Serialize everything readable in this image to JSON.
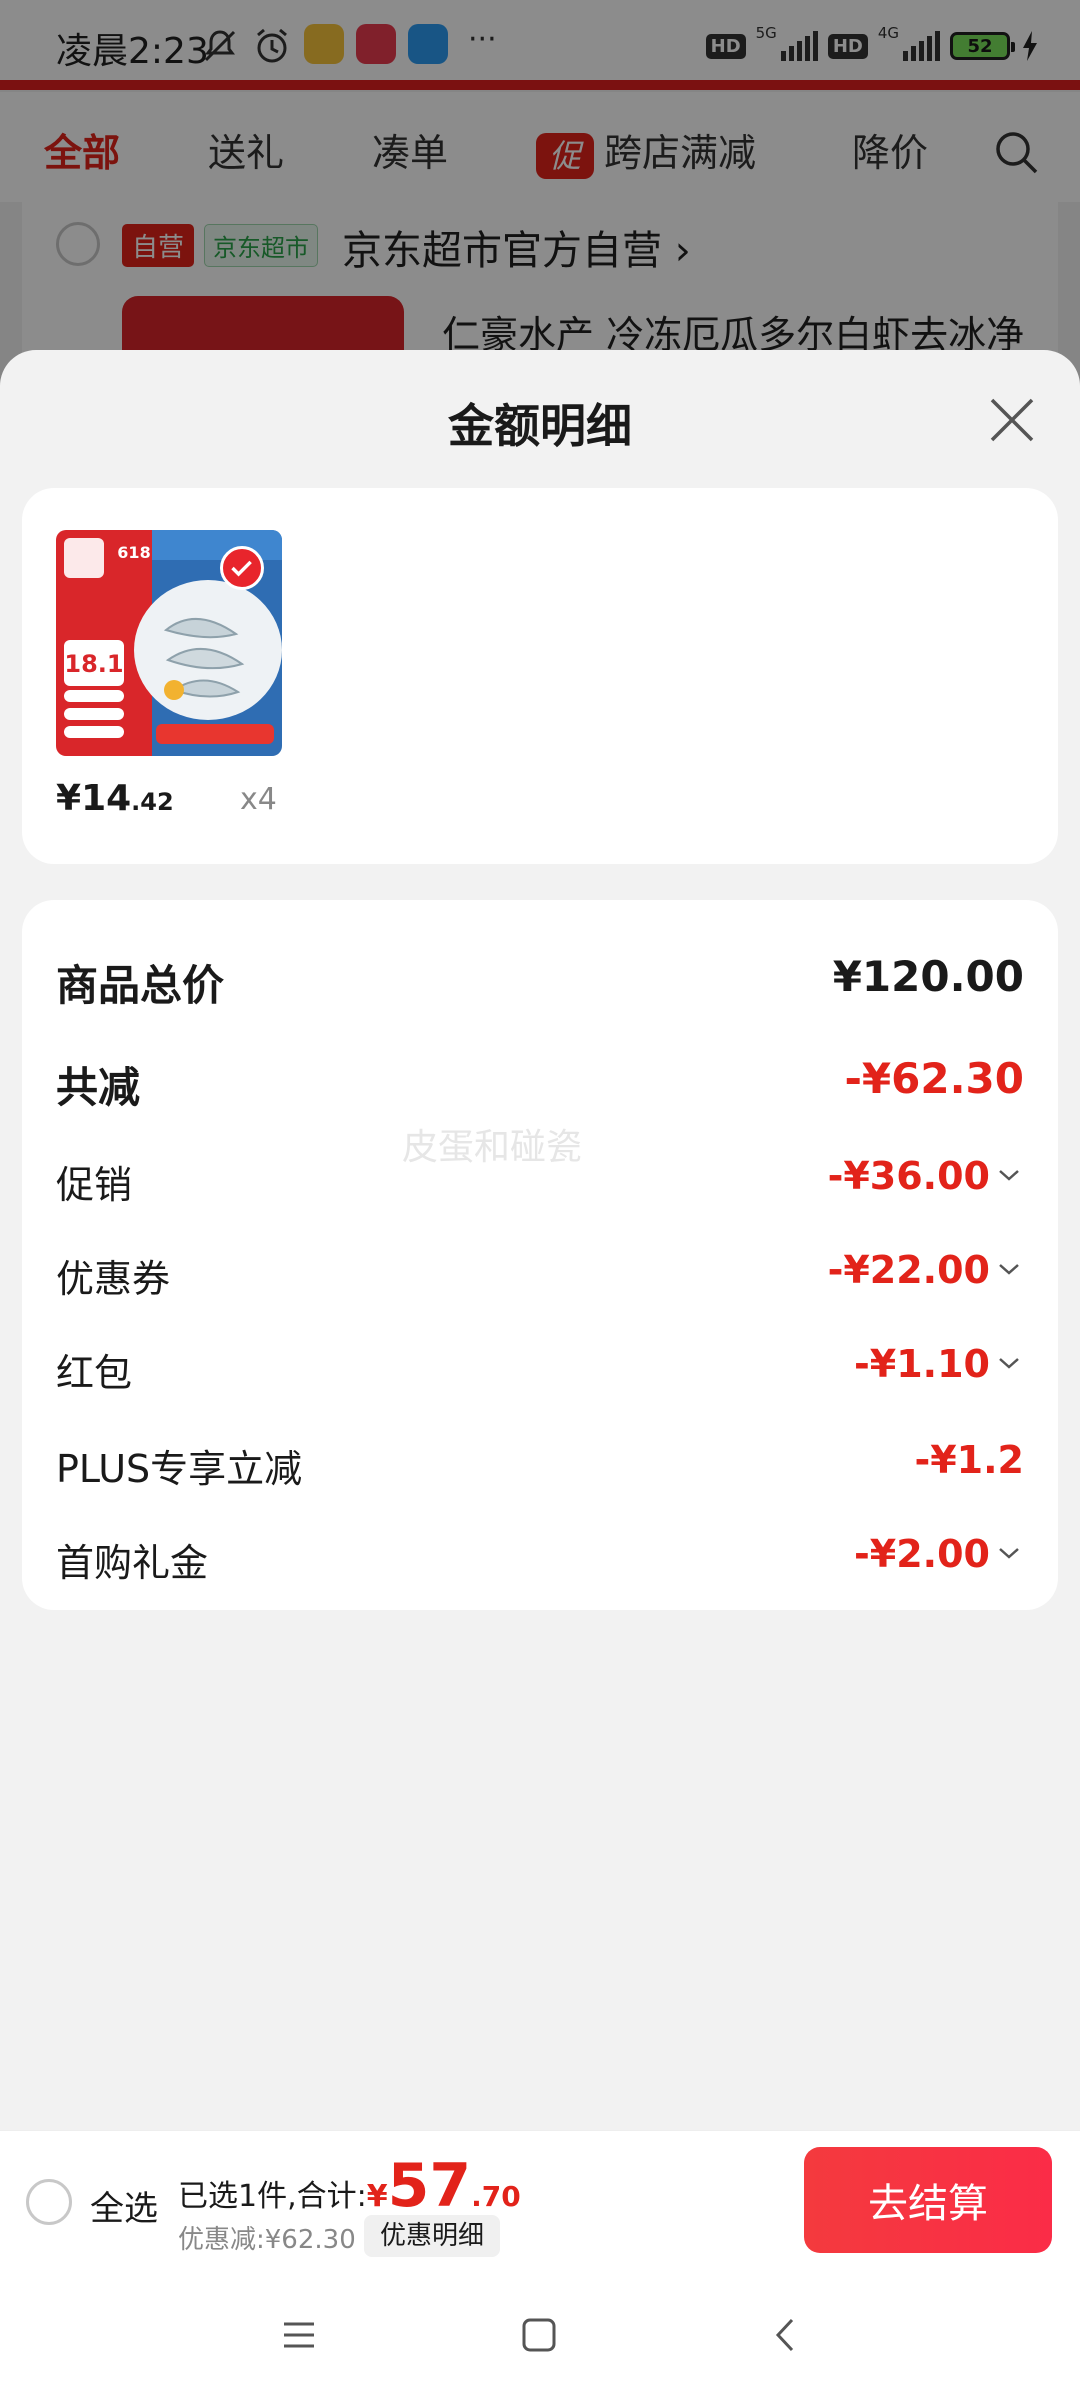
{
  "status_bar": {
    "time": "凌晨2:23",
    "more": "···",
    "hd_1": "HD",
    "network_1": "5G",
    "hd_2": "HD",
    "network_2": "4G",
    "battery": "52"
  },
  "background": {
    "tabs": [
      "全部",
      "送礼",
      "凑单",
      "跨店满减",
      "降价"
    ],
    "promo_badge": "促",
    "store": {
      "tag_self": "自营",
      "tag_supermarket": "京东超市",
      "name": "京东超市官方自营 ›",
      "item_title": "仁豪水产 冷冻厄瓜多尔白虾去冰净"
    }
  },
  "sheet": {
    "title": "金额明细",
    "product": {
      "price_symbol": "¥",
      "price_int": "14",
      "price_dec": ".42",
      "quantity": "x4"
    },
    "rows": {
      "total_label": "商品总价",
      "total_value": "¥120.00",
      "reduce_label": "共减",
      "reduce_value": "-¥62.30",
      "promo_label": "促销",
      "promo_value": "-¥36.00",
      "coupon_label": "优惠券",
      "coupon_value": "-¥22.00",
      "redpacket_label": "红包",
      "redpacket_value": "-¥1.10",
      "plus_label": "PLUS专享立减",
      "plus_value": "-¥1.2",
      "gift_label": "首购礼金",
      "gift_value": "-¥2.00"
    },
    "watermark": "皮蛋和碰瓷"
  },
  "bottom_bar": {
    "select_all": "全选",
    "summary_prefix": "已选1件,合计:",
    "currency": "¥",
    "total_int": "57",
    "total_dec": ".70",
    "discount": "优惠减:¥62.30",
    "discount_detail_button": "优惠明细",
    "checkout_button": "去结算"
  },
  "colors": {
    "accent_red": "#e2231a",
    "checkout_gradient_start": "#f43a3e",
    "sheet_bg": "#f2f2f2"
  }
}
